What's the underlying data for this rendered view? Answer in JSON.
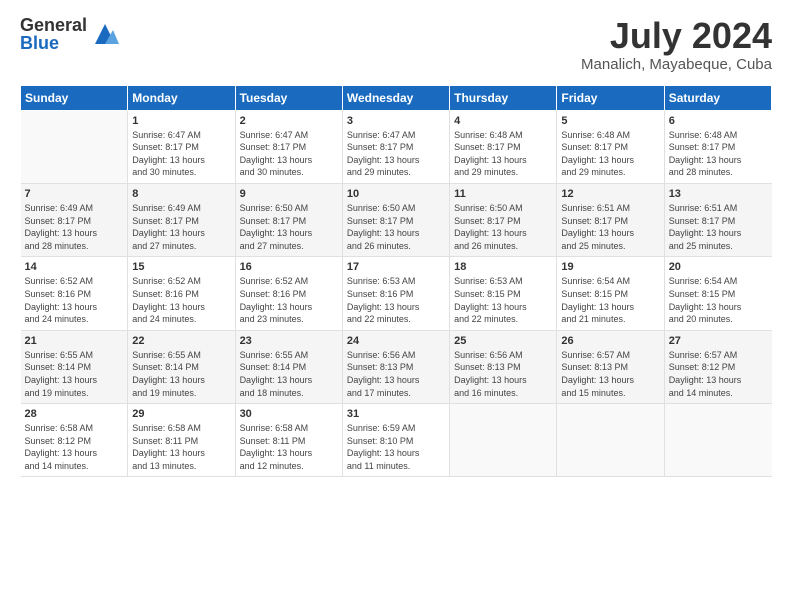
{
  "logo": {
    "general": "General",
    "blue": "Blue"
  },
  "title": {
    "month": "July 2024",
    "location": "Manalich, Mayabeque, Cuba"
  },
  "calendar": {
    "headers": [
      "Sunday",
      "Monday",
      "Tuesday",
      "Wednesday",
      "Thursday",
      "Friday",
      "Saturday"
    ],
    "weeks": [
      [
        {
          "day": "",
          "content": ""
        },
        {
          "day": "1",
          "content": "Sunrise: 6:47 AM\nSunset: 8:17 PM\nDaylight: 13 hours\nand 30 minutes."
        },
        {
          "day": "2",
          "content": "Sunrise: 6:47 AM\nSunset: 8:17 PM\nDaylight: 13 hours\nand 30 minutes."
        },
        {
          "day": "3",
          "content": "Sunrise: 6:47 AM\nSunset: 8:17 PM\nDaylight: 13 hours\nand 29 minutes."
        },
        {
          "day": "4",
          "content": "Sunrise: 6:48 AM\nSunset: 8:17 PM\nDaylight: 13 hours\nand 29 minutes."
        },
        {
          "day": "5",
          "content": "Sunrise: 6:48 AM\nSunset: 8:17 PM\nDaylight: 13 hours\nand 29 minutes."
        },
        {
          "day": "6",
          "content": "Sunrise: 6:48 AM\nSunset: 8:17 PM\nDaylight: 13 hours\nand 28 minutes."
        }
      ],
      [
        {
          "day": "7",
          "content": "Sunrise: 6:49 AM\nSunset: 8:17 PM\nDaylight: 13 hours\nand 28 minutes."
        },
        {
          "day": "8",
          "content": "Sunrise: 6:49 AM\nSunset: 8:17 PM\nDaylight: 13 hours\nand 27 minutes."
        },
        {
          "day": "9",
          "content": "Sunrise: 6:50 AM\nSunset: 8:17 PM\nDaylight: 13 hours\nand 27 minutes."
        },
        {
          "day": "10",
          "content": "Sunrise: 6:50 AM\nSunset: 8:17 PM\nDaylight: 13 hours\nand 26 minutes."
        },
        {
          "day": "11",
          "content": "Sunrise: 6:50 AM\nSunset: 8:17 PM\nDaylight: 13 hours\nand 26 minutes."
        },
        {
          "day": "12",
          "content": "Sunrise: 6:51 AM\nSunset: 8:17 PM\nDaylight: 13 hours\nand 25 minutes."
        },
        {
          "day": "13",
          "content": "Sunrise: 6:51 AM\nSunset: 8:17 PM\nDaylight: 13 hours\nand 25 minutes."
        }
      ],
      [
        {
          "day": "14",
          "content": "Sunrise: 6:52 AM\nSunset: 8:16 PM\nDaylight: 13 hours\nand 24 minutes."
        },
        {
          "day": "15",
          "content": "Sunrise: 6:52 AM\nSunset: 8:16 PM\nDaylight: 13 hours\nand 24 minutes."
        },
        {
          "day": "16",
          "content": "Sunrise: 6:52 AM\nSunset: 8:16 PM\nDaylight: 13 hours\nand 23 minutes."
        },
        {
          "day": "17",
          "content": "Sunrise: 6:53 AM\nSunset: 8:16 PM\nDaylight: 13 hours\nand 22 minutes."
        },
        {
          "day": "18",
          "content": "Sunrise: 6:53 AM\nSunset: 8:15 PM\nDaylight: 13 hours\nand 22 minutes."
        },
        {
          "day": "19",
          "content": "Sunrise: 6:54 AM\nSunset: 8:15 PM\nDaylight: 13 hours\nand 21 minutes."
        },
        {
          "day": "20",
          "content": "Sunrise: 6:54 AM\nSunset: 8:15 PM\nDaylight: 13 hours\nand 20 minutes."
        }
      ],
      [
        {
          "day": "21",
          "content": "Sunrise: 6:55 AM\nSunset: 8:14 PM\nDaylight: 13 hours\nand 19 minutes."
        },
        {
          "day": "22",
          "content": "Sunrise: 6:55 AM\nSunset: 8:14 PM\nDaylight: 13 hours\nand 19 minutes."
        },
        {
          "day": "23",
          "content": "Sunrise: 6:55 AM\nSunset: 8:14 PM\nDaylight: 13 hours\nand 18 minutes."
        },
        {
          "day": "24",
          "content": "Sunrise: 6:56 AM\nSunset: 8:13 PM\nDaylight: 13 hours\nand 17 minutes."
        },
        {
          "day": "25",
          "content": "Sunrise: 6:56 AM\nSunset: 8:13 PM\nDaylight: 13 hours\nand 16 minutes."
        },
        {
          "day": "26",
          "content": "Sunrise: 6:57 AM\nSunset: 8:13 PM\nDaylight: 13 hours\nand 15 minutes."
        },
        {
          "day": "27",
          "content": "Sunrise: 6:57 AM\nSunset: 8:12 PM\nDaylight: 13 hours\nand 14 minutes."
        }
      ],
      [
        {
          "day": "28",
          "content": "Sunrise: 6:58 AM\nSunset: 8:12 PM\nDaylight: 13 hours\nand 14 minutes."
        },
        {
          "day": "29",
          "content": "Sunrise: 6:58 AM\nSunset: 8:11 PM\nDaylight: 13 hours\nand 13 minutes."
        },
        {
          "day": "30",
          "content": "Sunrise: 6:58 AM\nSunset: 8:11 PM\nDaylight: 13 hours\nand 12 minutes."
        },
        {
          "day": "31",
          "content": "Sunrise: 6:59 AM\nSunset: 8:10 PM\nDaylight: 13 hours\nand 11 minutes."
        },
        {
          "day": "",
          "content": ""
        },
        {
          "day": "",
          "content": ""
        },
        {
          "day": "",
          "content": ""
        }
      ]
    ]
  }
}
